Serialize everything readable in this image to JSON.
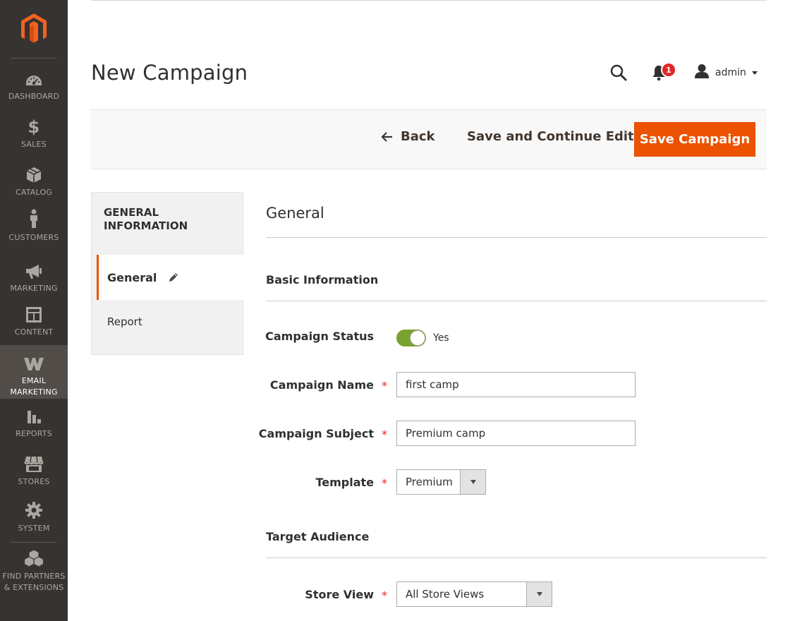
{
  "sidebar": {
    "items": [
      {
        "label": "DASHBOARD",
        "icon": "dashboard-icon"
      },
      {
        "label": "SALES",
        "icon": "dollar-icon"
      },
      {
        "label": "CATALOG",
        "icon": "box-icon"
      },
      {
        "label": "CUSTOMERS",
        "icon": "person-icon"
      },
      {
        "label": "MARKETING",
        "icon": "megaphone-icon"
      },
      {
        "label": "CONTENT",
        "icon": "layout-icon"
      },
      {
        "label": "EMAIL MARKETING",
        "icon": "w-logo-icon"
      },
      {
        "label": "REPORTS",
        "icon": "bar-chart-icon"
      },
      {
        "label": "STORES",
        "icon": "storefront-icon"
      },
      {
        "label": "SYSTEM",
        "icon": "gear-icon"
      },
      {
        "label": "FIND PARTNERS & EXTENSIONS",
        "icon": "boxes-icon"
      }
    ],
    "active_index": 6
  },
  "header": {
    "title": "New Campaign",
    "notification_count": "1",
    "user_name": "admin"
  },
  "actions": {
    "back": "Back",
    "save_continue": "Save and Continue Edit",
    "save": "Save Campaign"
  },
  "tabs": {
    "heading": "GENERAL INFORMATION",
    "general": "General",
    "report": "Report"
  },
  "form": {
    "section_title": "General",
    "basic_info_title": "Basic Information",
    "status_label": "Campaign Status",
    "status_value": "Yes",
    "name_label": "Campaign Name",
    "name_value": "first camp",
    "subject_label": "Campaign Subject",
    "subject_value": "Premium camp",
    "template_label": "Template",
    "template_value": "Premium",
    "target_title": "Target Audience",
    "store_view_label": "Store View",
    "store_view_value": "All Store Views",
    "required_mark": "*"
  },
  "colors": {
    "sidebar_bg": "#373330",
    "sidebar_active": "#524d49",
    "accent": "#eb5202",
    "toggle_on": "#79a22e",
    "required": "#e22626"
  }
}
